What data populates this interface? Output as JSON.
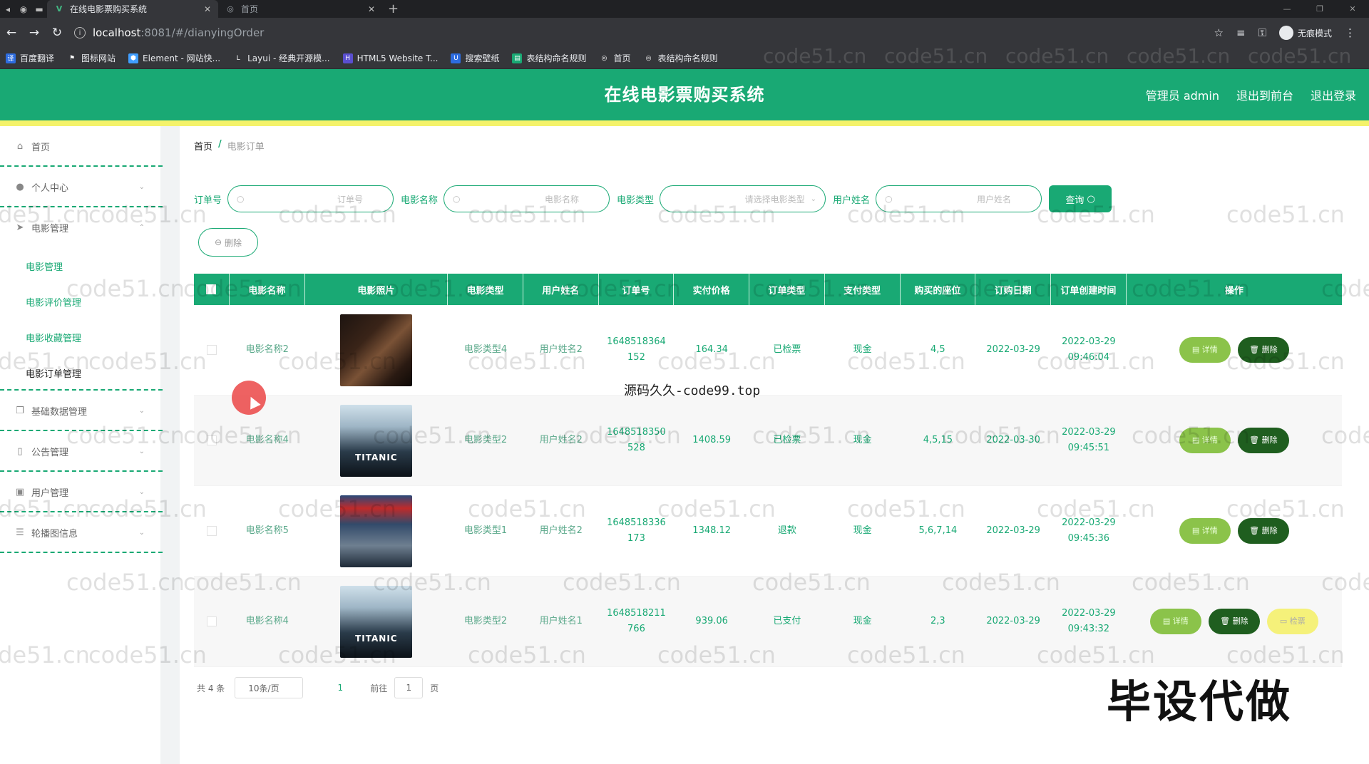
{
  "browser": {
    "tabs": [
      {
        "title": "在线电影票购买系统",
        "active": true,
        "icon": "vue-icon"
      },
      {
        "title": "首页",
        "active": false,
        "icon": "globe-icon"
      }
    ],
    "url_host": "localhost",
    "url_path": ":8081/#/dianyingOrder",
    "incognito_label": "无痕模式",
    "bookmarks": [
      "百度翻译",
      "图标网站",
      "Element - 网站快...",
      "Layui - 经典开源模...",
      "HTML5 Website T...",
      "搜索壁纸",
      "表结构命名规则",
      "首页",
      "表结构命名规则"
    ]
  },
  "header": {
    "title": "在线电影票购买系统",
    "admin_label": "管理员 admin",
    "back_front_label": "退出到前台",
    "logout_label": "退出登录"
  },
  "sidebar": {
    "home": "首页",
    "personal": "个人中心",
    "movie_group": "电影管理",
    "movie_subs": [
      "电影管理",
      "电影评价管理",
      "电影收藏管理",
      "电影订单管理"
    ],
    "base_data": "基础数据管理",
    "notice": "公告管理",
    "user": "用户管理",
    "carousel": "轮播图信息"
  },
  "breadcrumb": {
    "home": "首页",
    "sep": "/",
    "current": "电影订单"
  },
  "filters": {
    "order_label": "订单号",
    "order_ph": "订单号",
    "name_label": "电影名称",
    "name_ph": "电影名称",
    "type_label": "电影类型",
    "type_ph": "请选择电影类型",
    "user_label": "用户姓名",
    "user_ph": "用户姓名",
    "query_label": "查询"
  },
  "batch_delete_label": "删除",
  "table": {
    "headers": [
      "电影名称",
      "电影照片",
      "电影类型",
      "用户姓名",
      "订单号",
      "实付价格",
      "订单类型",
      "支付类型",
      "购买的座位",
      "订购日期",
      "订单创建时间",
      "操作"
    ],
    "rows": [
      {
        "name": "电影名称2",
        "poster": "",
        "type": "电影类型4",
        "user": "用户姓名2",
        "order_a": "1648518364",
        "order_b": "152",
        "price": "164.34",
        "otype": "已检票",
        "pay": "现金",
        "seats": "4,5",
        "date": "2022-03-29",
        "created_a": "2022-03-29",
        "created_b": "09:46:04"
      },
      {
        "name": "电影名称4",
        "poster": "TITANIC",
        "type": "电影类型2",
        "user": "用户姓名2",
        "order_a": "1648518350",
        "order_b": "528",
        "price": "1408.59",
        "otype": "已检票",
        "pay": "现金",
        "seats": "4,5,15",
        "date": "2022-03-30",
        "created_a": "2022-03-29",
        "created_b": "09:45:51"
      },
      {
        "name": "电影名称5",
        "poster": "",
        "type": "电影类型1",
        "user": "用户姓名2",
        "order_a": "1648518336",
        "order_b": "173",
        "price": "1348.12",
        "otype": "退款",
        "pay": "现金",
        "seats": "5,6,7,14",
        "date": "2022-03-29",
        "created_a": "2022-03-29",
        "created_b": "09:45:36"
      },
      {
        "name": "电影名称4",
        "poster": "TITANIC",
        "type": "电影类型2",
        "user": "用户姓名1",
        "order_a": "1648518211",
        "order_b": "766",
        "price": "939.06",
        "otype": "已支付",
        "pay": "现金",
        "seats": "2,3",
        "date": "2022-03-29",
        "created_a": "2022-03-29",
        "created_b": "09:43:32"
      }
    ],
    "detail_label": "详情",
    "delete_label": "删除",
    "checkin_label": "检票"
  },
  "pager": {
    "total": "共 4 条",
    "page_size": "10条/页",
    "page": "1",
    "goto_label": "前往",
    "goto_value": "1",
    "page_suffix": "页"
  },
  "overlays": {
    "mid_text": "源码久久-code99.top",
    "big_text": "毕设代做",
    "watermark": "code51.cn"
  },
  "colors": {
    "primary": "#19a974",
    "stripe": "#f4f26a",
    "detail_btn": "#8bc34a",
    "delete_btn": "#1f5e1f",
    "checkin_btn": "#f5f17a"
  }
}
